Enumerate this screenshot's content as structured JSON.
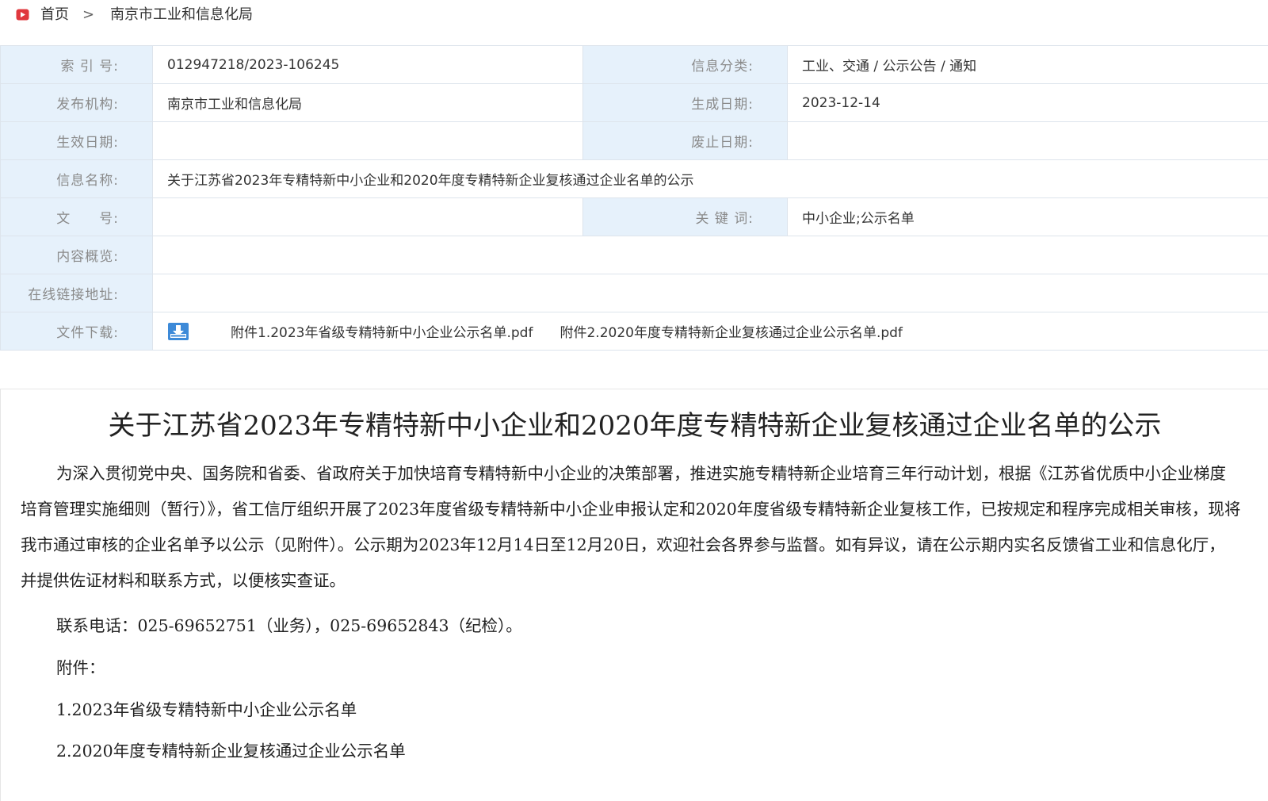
{
  "breadcrumb": {
    "home": "首页",
    "separator": ">",
    "current": "南京市工业和信息化局"
  },
  "meta": {
    "index_label": "索 引 号:",
    "index_value": "012947218/2023-106245",
    "category_label": "信息分类:",
    "category_value": "工业、交通 / 公示公告 / 通知",
    "publisher_label": "发布机构:",
    "publisher_value": "南京市工业和信息化局",
    "created_label": "生成日期:",
    "created_value": "2023-12-14",
    "effective_label": "生效日期:",
    "effective_value": "",
    "expire_label": "废止日期:",
    "expire_value": "",
    "name_label": "信息名称:",
    "name_value": "关于江苏省2023年专精特新中小企业和2020年度专精特新企业复核通过企业名单的公示",
    "docno_label": "文　　号:",
    "docno_value": "",
    "keywords_label": "关 键 词:",
    "keywords_value": "中小企业;公示名单",
    "summary_label": "内容概览:",
    "summary_value": "",
    "link_label": "在线链接地址:",
    "link_value": "",
    "download_label": "文件下载:",
    "attachments": [
      "附件1.2023年省级专精特新中小企业公示名单.pdf",
      "附件2.2020年度专精特新企业复核通过企业公示名单.pdf"
    ]
  },
  "article": {
    "title": "关于江苏省2023年专精特新中小企业和2020年度专精特新企业复核通过企业名单的公示",
    "body": "为深入贯彻党中央、国务院和省委、省政府关于加快培育专精特新中小企业的决策部署，推进实施专精特新企业培育三年行动计划，根据《江苏省优质中小企业梯度培育管理实施细则（暂行）》，省工信厅组织开展了2023年度省级专精特新中小企业申报认定和2020年度省级专精特新企业复核工作，已按规定和程序完成相关审核，现将我市通过审核的企业名单予以公示（见附件）。公示期为2023年12月14日至12月20日，欢迎社会各界参与监督。如有异议，请在公示期内实名反馈省工业和信息化厅，并提供佐证材料和联系方式，以便核实查证。",
    "contact": "联系电话：025-69652751（业务），025-69652843（纪检）。",
    "attachments_heading": "附件：",
    "attachment_items": [
      "1.2023年省级专精特新中小企业公示名单",
      "2.2020年度专精特新企业复核通过企业公示名单"
    ]
  },
  "colors": {
    "label_bg": "#e6f1fb",
    "border": "#dde4ec",
    "home_icon": "#e0383e",
    "download_icon": "#3d8ad8"
  },
  "icons": [
    "home-icon",
    "download-icon"
  ]
}
